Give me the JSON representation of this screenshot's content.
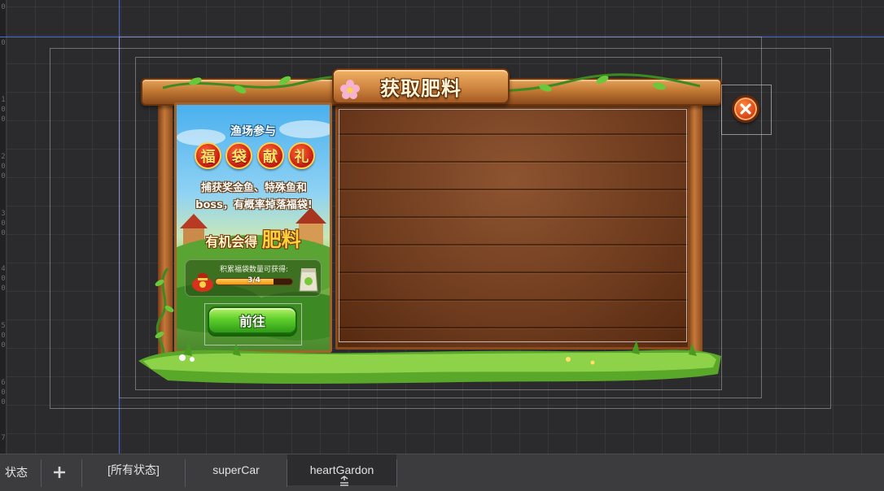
{
  "ruler": {
    "numbers": [
      "0",
      "0",
      "1",
      "0",
      "0",
      "2",
      "0",
      "0",
      "3",
      "0",
      "0",
      "4",
      "0",
      "0",
      "5",
      "0",
      "0",
      "6",
      "0",
      "0",
      "7"
    ]
  },
  "dialog": {
    "title": "获取肥料",
    "ad": {
      "subtitle": "渔场参与",
      "fudai_chars": [
        "福",
        "袋",
        "献",
        "礼"
      ],
      "description_line1": "捕获奖金鱼、特殊鱼和",
      "description_line2": "boss，有概率掉落福袋!",
      "reward_prefix": "有机会得",
      "reward_item": "肥料",
      "progress_label": "积累福袋数量可获得:",
      "progress_text": "3/4",
      "progress_value": 0.75,
      "go_label": "前往"
    },
    "close_icon": "close-x-icon"
  },
  "statebar": {
    "label": "状态",
    "add_icon": "plus-icon",
    "tabs": [
      {
        "label": "[所有状态]",
        "active": false
      },
      {
        "label": "superCar",
        "active": false
      },
      {
        "label": "heartGardon",
        "active": true
      }
    ]
  },
  "colors": {
    "canvas_bg": "#2b2b2d",
    "guide": "#4a6fd8",
    "wood": "#6e3b1e",
    "frame": "#c5793a",
    "button_green": "#5fcf2c",
    "close_orange": "#d8461a",
    "tabbar": "#3c3c3f"
  }
}
